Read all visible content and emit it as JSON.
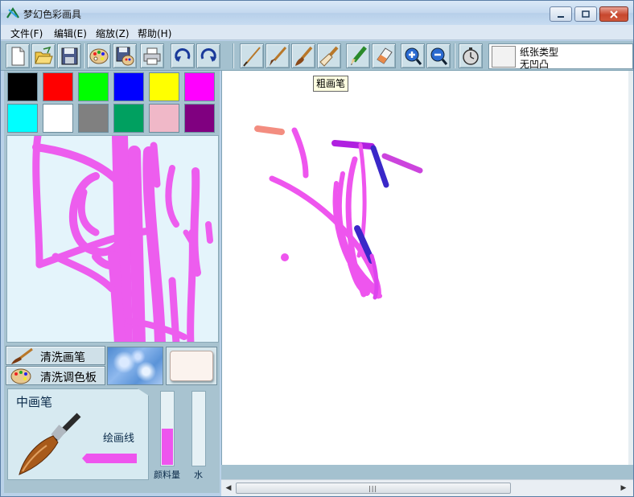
{
  "window": {
    "title": "梦幻色彩画具"
  },
  "menu": [
    {
      "label": "文件(F)"
    },
    {
      "label": "编辑(E)"
    },
    {
      "label": "缩放(Z)"
    },
    {
      "label": "帮助(H)"
    }
  ],
  "toolbar": {
    "file_tools": [
      "new-file-icon",
      "open-folder-icon",
      "save-disk-icon",
      "palette-icon",
      "save-palette-icon",
      "printer-icon",
      "undo-icon",
      "redo-icon"
    ],
    "brush_tools": [
      "fine-brush-icon",
      "medium-brush-icon",
      "thick-brush-icon",
      "wide-brush-icon",
      "pencil-icon",
      "eraser-icon",
      "zoom-in-icon",
      "zoom-out-icon",
      "timer-icon"
    ],
    "paper_type_label": "纸张类型",
    "paper_type_value": "无凹凸"
  },
  "tooltip": "粗画笔",
  "palette": {
    "colors": [
      "#000000",
      "#ff0000",
      "#00ff00",
      "#0000ff",
      "#ffff00",
      "#ff00ff",
      "#00ffff",
      "#ffffff",
      "#808080",
      "#00a060",
      "#f0b8c8",
      "#800080"
    ]
  },
  "left_tools": {
    "wash_brush_label": "清洗画笔",
    "wash_palette_label": "清洗调色板"
  },
  "brush_panel": {
    "name": "中画笔",
    "line_label": "绘画线",
    "current_color": "#ee55ee"
  },
  "meters": {
    "paint_label": "颜料量",
    "paint_level": 0.5,
    "water_label": "水",
    "water_level": 0.0
  },
  "colors": {
    "paint_pink": "#ee55ee",
    "paint_purple": "#b020e0",
    "paint_blue": "#3a28c8",
    "paint_salmon": "#f07060",
    "panel_bg": "#a8c3d0"
  }
}
